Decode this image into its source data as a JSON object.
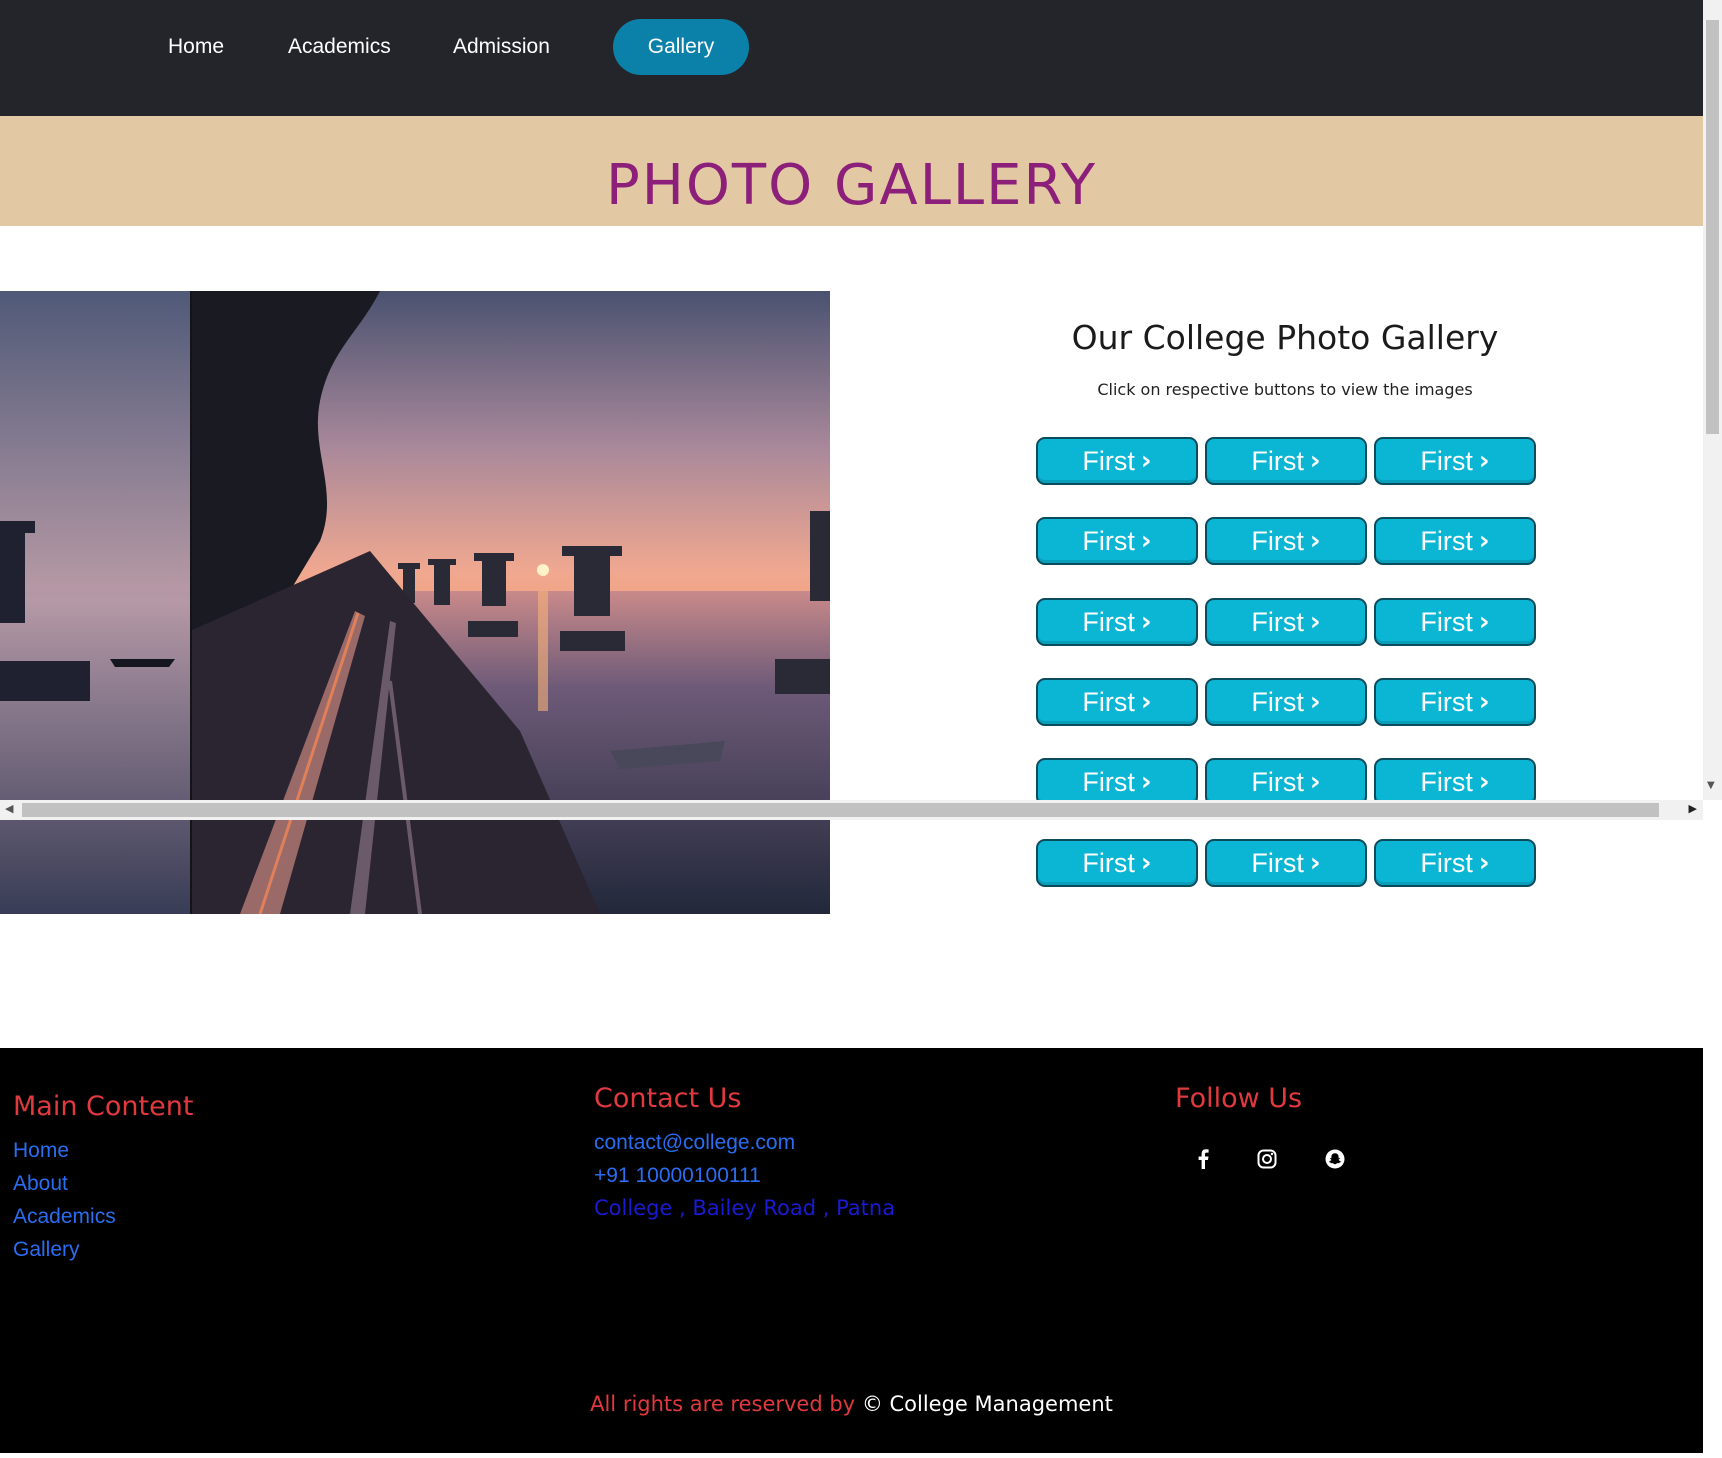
{
  "nav": {
    "items": [
      {
        "label": "Home"
      },
      {
        "label": "Academics"
      },
      {
        "label": "Admission"
      },
      {
        "label": "Gallery",
        "active": true
      }
    ]
  },
  "banner": {
    "title": "PHOTO GALLERY"
  },
  "gallery": {
    "title": "Our College Photo Gallery",
    "subtitle": "Click on respective buttons to view the images",
    "button_label": "First",
    "button_icon": "chevron-right-icon",
    "button_color": "#0bb5d4",
    "rows": 6,
    "cols": 3
  },
  "footer": {
    "main_heading": "Main Content",
    "main_links": [
      "Home",
      "About",
      "Academics",
      "Gallery"
    ],
    "contact_heading": "Contact Us",
    "email": "contact@college.com",
    "phone": "+91 10000100111",
    "address": "College , Bailey Road , Patna",
    "follow_heading": "Follow Us",
    "socials": [
      "facebook-icon",
      "instagram-icon",
      "snapchat-icon"
    ],
    "copyright_prefix": "All rights are reserved by",
    "copyright_symbol": "©",
    "copyright_owner": "College Management"
  },
  "colors": {
    "nav_bg": "#23252b",
    "active_tab": "#0b80a8",
    "banner_bg": "#e2c9a4",
    "banner_title": "#8b1f7a",
    "footer_heading": "#e0393e",
    "footer_link": "#2a6df0"
  }
}
